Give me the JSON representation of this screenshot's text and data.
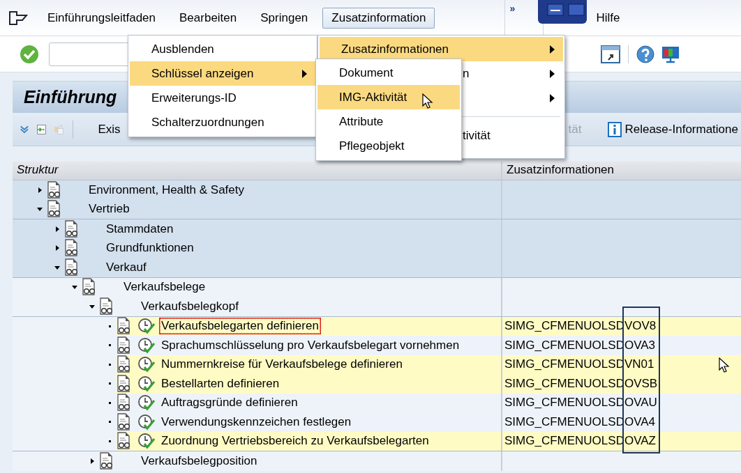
{
  "menu_bar": {
    "items": [
      {
        "label": "Einführungsleitfaden",
        "selected": false
      },
      {
        "label": "Bearbeiten",
        "selected": false
      },
      {
        "label": "Springen",
        "selected": false
      },
      {
        "label": "Zusatzinformation",
        "selected": true
      }
    ],
    "more": "»",
    "help": {
      "label": "Hilfe",
      "selected": false
    }
  },
  "title": "Einführung",
  "app_toolbar": {
    "buttons": [
      {
        "label": "Exis",
        "disabled": false,
        "kind": "text"
      },
      {
        "label": "tät",
        "disabled": true,
        "kind": "text"
      },
      {
        "label": "Release-Informatione",
        "disabled": false,
        "kind": "info"
      }
    ]
  },
  "menus": [
    {
      "items": [
        {
          "label": "Ausblenden",
          "selected": false,
          "submenu": false,
          "kind": "normal"
        },
        {
          "label": "Schlüssel anzeigen",
          "selected": true,
          "submenu": true,
          "kind": "normal"
        },
        {
          "label": "Erweiterungs-ID",
          "selected": false,
          "submenu": false,
          "kind": "normal"
        },
        {
          "label": "Schalterzuordnungen",
          "selected": false,
          "submenu": false,
          "kind": "normal"
        }
      ]
    },
    {
      "items": [
        {
          "label": "Zusatzinformationen",
          "selected": true,
          "submenu": true,
          "kind": "normal"
        },
        {
          "label": "n",
          "selected": false,
          "submenu": true,
          "kind": "clipped"
        },
        {
          "selected": false,
          "submenu": true,
          "kind": "clipped"
        },
        {
          "kind": "separator"
        },
        {
          "label": "tivität",
          "selected": false,
          "submenu": false,
          "kind": "clipped"
        }
      ]
    },
    {
      "items": [
        {
          "label": "Dokument",
          "selected": false,
          "submenu": false,
          "kind": "normal"
        },
        {
          "label": "IMG-Aktivität",
          "selected": true,
          "submenu": false,
          "kind": "normal"
        },
        {
          "label": "Attribute",
          "selected": false,
          "submenu": false,
          "kind": "normal"
        },
        {
          "label": "Pflegeobjekt",
          "selected": false,
          "submenu": false,
          "kind": "normal"
        }
      ]
    }
  ],
  "tree": {
    "columns": [
      "Struktur",
      "Zusatzinformationen"
    ],
    "frame_marked": true,
    "nodes": [
      {
        "label": "Environment, Health & Safety",
        "expanded": false
      },
      {
        "label": "Vertrieb",
        "expanded": true,
        "children": [
          {
            "label": "Stammdaten",
            "expanded": false
          },
          {
            "label": "Grundfunktionen",
            "expanded": false
          },
          {
            "label": "Verkauf",
            "expanded": true,
            "children": [
              {
                "label": "Verkaufsbelege",
                "expanded": true,
                "children": [
                  {
                    "label": "Verkaufsbelegkopf",
                    "expanded": true,
                    "children": [
                      {
                        "kind": "activity",
                        "label": "Verkaufsbelegarten definieren",
                        "code": "SIMG_CFMENUOLSDVOV8",
                        "highlighted": true,
                        "focused": true
                      },
                      {
                        "kind": "activity",
                        "label": "Sprachumschlüsselung pro Verkaufsbelegart vornehmen",
                        "code": "SIMG_CFMENUOLSDOVA3",
                        "highlighted": false,
                        "focused": false
                      },
                      {
                        "kind": "activity",
                        "label": "Nummernkreise für Verkaufsbelege definieren",
                        "code": "SIMG_CFMENUOLSDVN01",
                        "highlighted": true,
                        "focused": false
                      },
                      {
                        "kind": "activity",
                        "label": "Bestellarten definieren",
                        "code": "SIMG_CFMENUOLSDOVSB",
                        "highlighted": true,
                        "focused": false
                      },
                      {
                        "kind": "activity",
                        "label": "Auftragsgründe definieren",
                        "code": "SIMG_CFMENUOLSDOVAU",
                        "highlighted": false,
                        "focused": false
                      },
                      {
                        "kind": "activity",
                        "label": "Verwendungskennzeichen festlegen",
                        "code": "SIMG_CFMENUOLSDOVA4",
                        "highlighted": false,
                        "focused": false
                      },
                      {
                        "kind": "activity",
                        "label": "Zuordnung Vertriebsbereich zu Verkaufsbelegarten",
                        "code": "SIMG_CFMENUOLSDOVAZ",
                        "highlighted": true,
                        "focused": false
                      }
                    ]
                  },
                  {
                    "label": "Verkaufsbelegposition",
                    "expanded": false
                  }
                ]
              }
            ]
          }
        ]
      }
    ]
  }
}
